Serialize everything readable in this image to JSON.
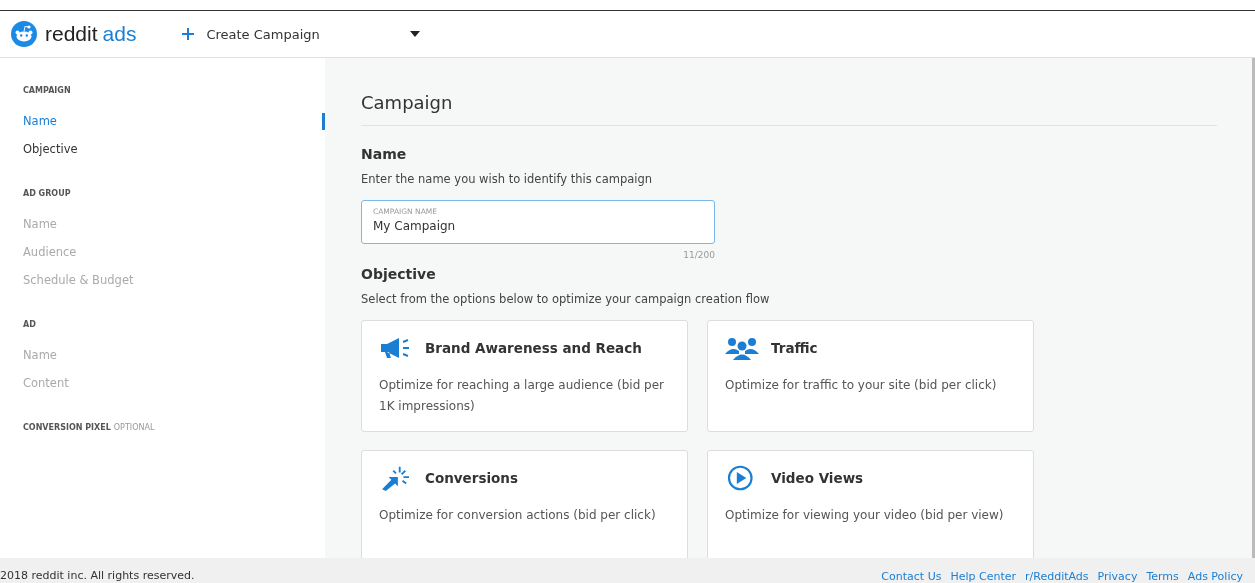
{
  "header": {
    "brand": "reddit",
    "brand_suffix": "ads",
    "create_label": "Create Campaign"
  },
  "sidebar": {
    "sections": [
      {
        "title": "CAMPAIGN",
        "items": [
          {
            "label": "Name",
            "selected": true,
            "disabled": false
          },
          {
            "label": "Objective",
            "selected": false,
            "disabled": false
          }
        ]
      },
      {
        "title": "AD GROUP",
        "items": [
          {
            "label": "Name",
            "selected": false,
            "disabled": true
          },
          {
            "label": "Audience",
            "selected": false,
            "disabled": true
          },
          {
            "label": "Schedule & Budget",
            "selected": false,
            "disabled": true
          }
        ]
      },
      {
        "title": "AD",
        "items": [
          {
            "label": "Name",
            "selected": false,
            "disabled": true
          },
          {
            "label": "Content",
            "selected": false,
            "disabled": true
          }
        ]
      },
      {
        "title": "CONVERSION PIXEL",
        "note": "OPTIONAL"
      }
    ]
  },
  "main": {
    "title": "Campaign",
    "name_section": {
      "heading": "Name",
      "description": "Enter the name you wish to identify this campaign",
      "field_label": "CAMPAIGN NAME",
      "value": "My Campaign",
      "counter": "11/200"
    },
    "objective_section": {
      "heading": "Objective",
      "description": "Select from the options below to optimize your campaign creation flow",
      "options": [
        {
          "kind": "megaphone",
          "title": "Brand Awareness and Reach",
          "description": "Optimize for reaching a large audience (bid per 1K impressions)"
        },
        {
          "kind": "people",
          "title": "Traffic",
          "description": "Optimize for traffic to your site (bid per click)"
        },
        {
          "kind": "click",
          "title": "Conversions",
          "description": "Optimize for conversion actions (bid per click)"
        },
        {
          "kind": "play",
          "title": "Video Views",
          "description": "Optimize for viewing your video (bid per view)"
        }
      ]
    }
  },
  "footer": {
    "copyright": "2018 reddit inc. All rights reserved.",
    "links": [
      "Contact Us",
      "Help Center",
      "r/RedditAds",
      "Privacy",
      "Terms",
      "Ads Policy"
    ]
  }
}
